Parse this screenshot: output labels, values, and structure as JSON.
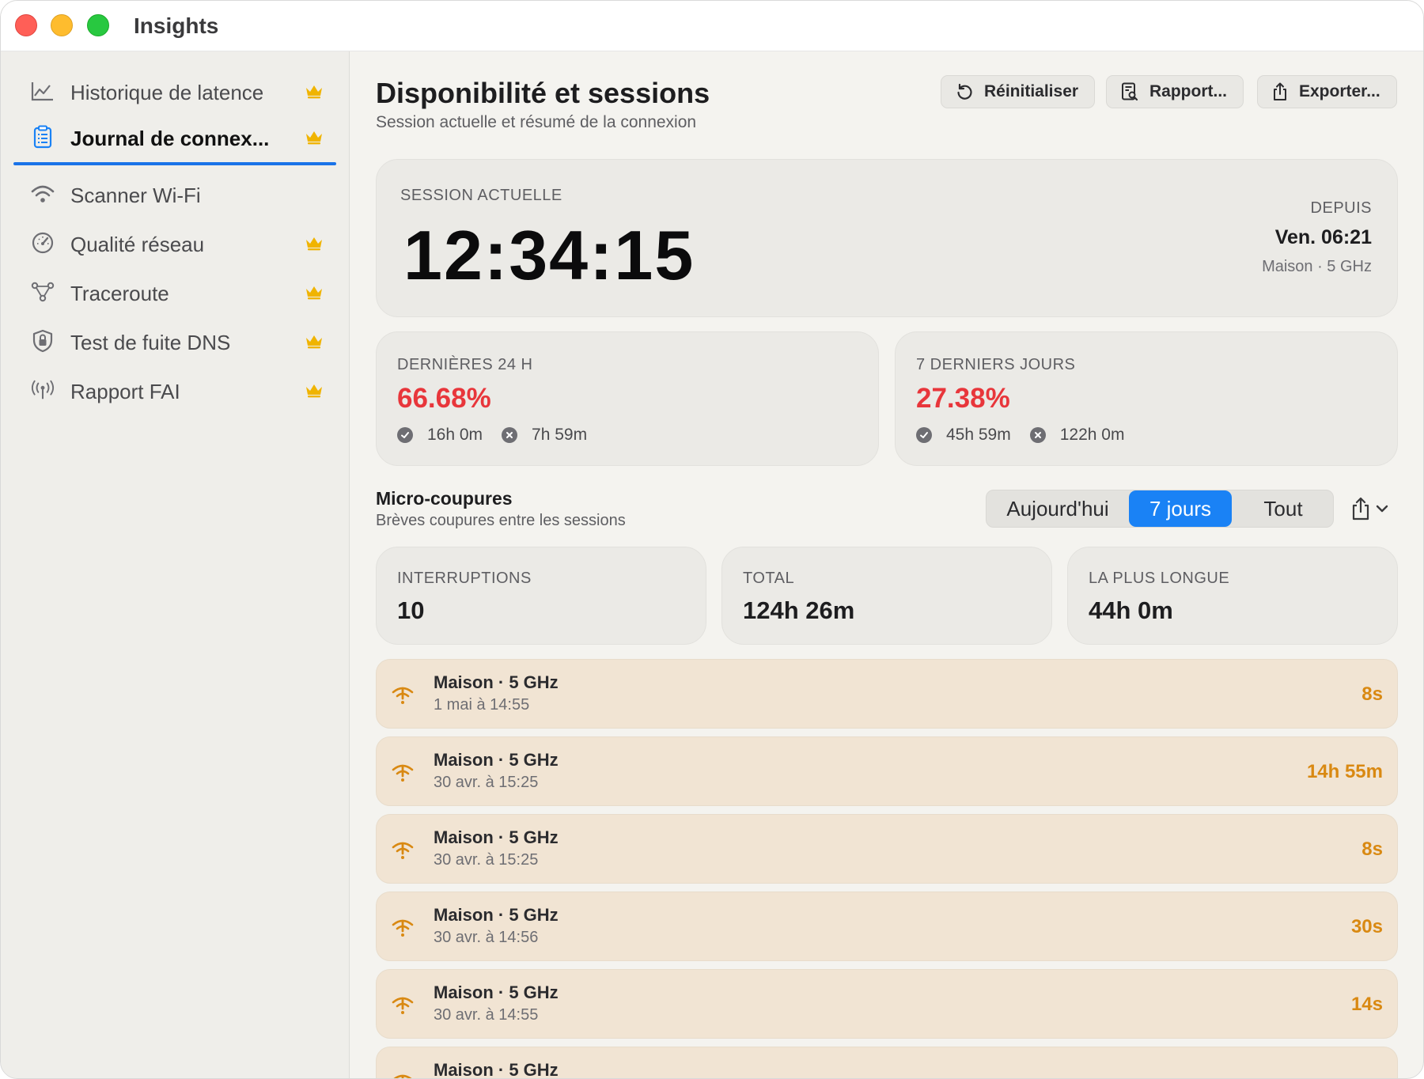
{
  "window": {
    "title": "Insights"
  },
  "sidebar": {
    "items": [
      {
        "label": "Historique de latence",
        "icon": "chart-line-icon",
        "premium": true
      },
      {
        "label": "Journal de connex...",
        "icon": "clipboard-list-icon",
        "premium": true,
        "active": true
      },
      {
        "label": "Scanner Wi-Fi",
        "icon": "wifi-icon",
        "premium": false
      },
      {
        "label": "Qualité réseau",
        "icon": "gauge-icon",
        "premium": true
      },
      {
        "label": "Traceroute",
        "icon": "route-nodes-icon",
        "premium": true
      },
      {
        "label": "Test de fuite DNS",
        "icon": "shield-lock-icon",
        "premium": true
      },
      {
        "label": "Rapport FAI",
        "icon": "antenna-icon",
        "premium": true
      }
    ]
  },
  "header": {
    "title": "Disponibilité et sessions",
    "subtitle": "Session actuelle et résumé de la connexion",
    "buttons": {
      "reset": "Réinitialiser",
      "report": "Rapport...",
      "export": "Exporter..."
    }
  },
  "current_session": {
    "caption": "SESSION ACTUELLE",
    "duration": "12:34:15",
    "since_caption": "DEPUIS",
    "since_value": "Ven. 06:21",
    "network": "Maison · 5 GHz"
  },
  "last24": {
    "caption": "DERNIÈRES 24 H",
    "percent": "66.68%",
    "up": "16h 0m",
    "down": "7h 59m"
  },
  "last7": {
    "caption": "7 DERNIERS JOURS",
    "percent": "27.38%",
    "up": "45h 59m",
    "down": "122h 0m"
  },
  "micro": {
    "title": "Micro-coupures",
    "subtitle": "Brèves coupures entre les sessions",
    "segments": [
      "Aujourd'hui",
      "7 jours",
      "Tout"
    ],
    "selected_segment": "7 jours",
    "stats": {
      "interruptions_caption": "INTERRUPTIONS",
      "interruptions_value": "10",
      "total_caption": "TOTAL",
      "total_value": "124h 26m",
      "longest_caption": "LA PLUS LONGUE",
      "longest_value": "44h 0m"
    },
    "rows": [
      {
        "network": "Maison · 5 GHz",
        "date": "1 mai à 14:55",
        "duration": "8s"
      },
      {
        "network": "Maison · 5 GHz",
        "date": "30 avr. à 15:25",
        "duration": "14h 55m"
      },
      {
        "network": "Maison · 5 GHz",
        "date": "30 avr. à 15:25",
        "duration": "8s"
      },
      {
        "network": "Maison · 5 GHz",
        "date": "30 avr. à 14:56",
        "duration": "30s"
      },
      {
        "network": "Maison · 5 GHz",
        "date": "30 avr. à 14:55",
        "duration": "14s"
      },
      {
        "network": "Maison · 5 GHz",
        "date": "",
        "duration": ""
      }
    ]
  },
  "colors": {
    "accent": "#1a82f5",
    "danger": "#e8363b",
    "warning": "#d98912",
    "premium": "#f0b400"
  }
}
